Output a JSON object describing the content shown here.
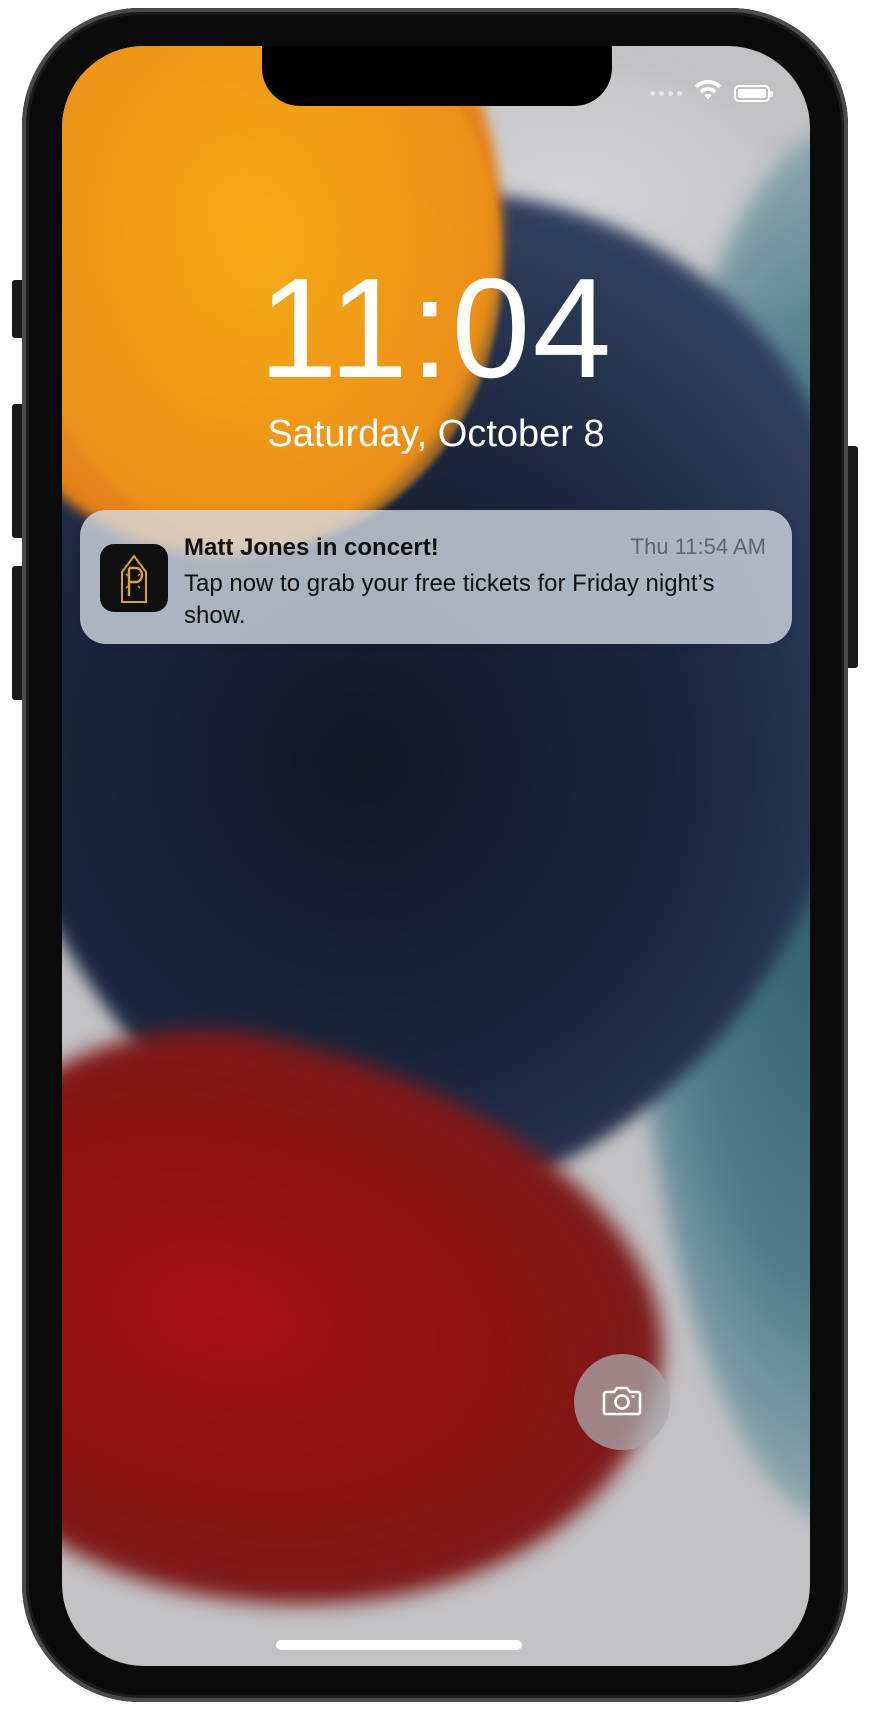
{
  "status_bar": {
    "wifi_icon": "wifi-icon",
    "battery_icon": "battery-icon",
    "signal_icon": "cellular-signal-icon"
  },
  "lock_screen": {
    "time": "11:04",
    "date": "Saturday, October 8"
  },
  "notification": {
    "app_icon": "app-logo-icon",
    "title": "Matt Jones in concert!",
    "timestamp": "Thu 11:54 AM",
    "body": "Tap now to grab your free tickets for Friday night’s show.",
    "icon_accent": "#d4a13a"
  },
  "quick_actions": {
    "camera_icon": "camera-icon"
  },
  "colors": {
    "notification_bg": "#d6dce6",
    "text_primary": "#111111",
    "text_secondary": "#5d6675"
  }
}
